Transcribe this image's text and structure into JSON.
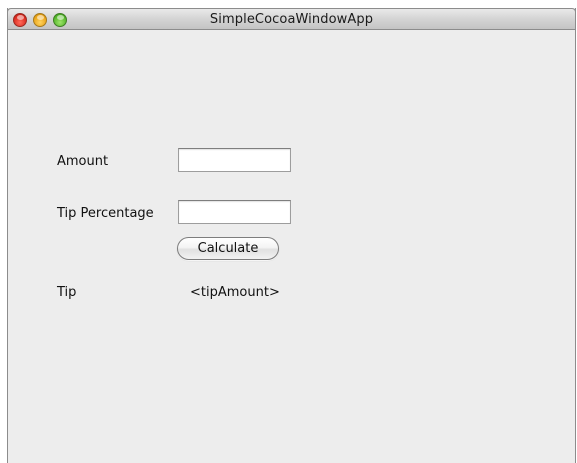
{
  "window": {
    "title": "SimpleCocoaWindowApp"
  },
  "form": {
    "amount_label": "Amount",
    "amount_value": "",
    "tip_percentage_label": "Tip Percentage",
    "tip_percentage_value": "",
    "calculate_label": "Calculate",
    "tip_label": "Tip",
    "tip_value": "<tipAmount>"
  }
}
